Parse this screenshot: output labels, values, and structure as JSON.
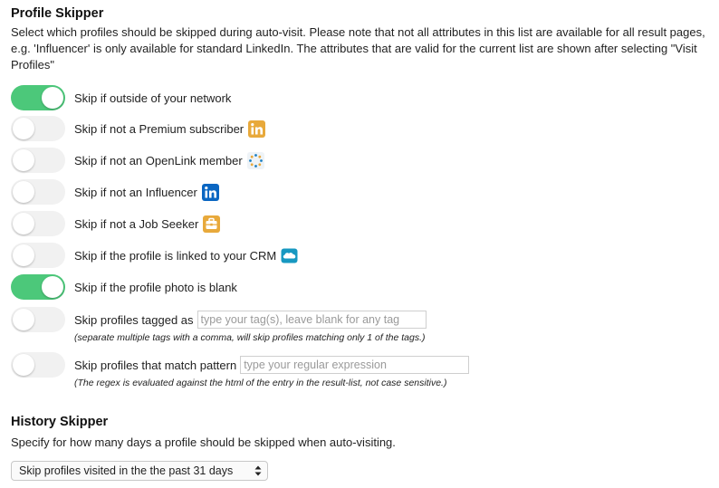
{
  "profile_skipper": {
    "title": "Profile Skipper",
    "description": "Select which profiles should be skipped during auto-visit. Please note that not all attributes in this list are available for all result pages, e.g. 'Influencer' is only available for standard LinkedIn. The attributes that are valid for the current list are shown after selecting \"Visit Profiles\"",
    "options": [
      {
        "label": "Skip if outside of your network",
        "enabled": true,
        "icon": ""
      },
      {
        "label": "Skip if not a Premium subscriber",
        "enabled": false,
        "icon": "linkedin-premium-icon"
      },
      {
        "label": "Skip if not an OpenLink member",
        "enabled": false,
        "icon": "openlink-icon"
      },
      {
        "label": "Skip if not an Influencer",
        "enabled": false,
        "icon": "linkedin-influencer-icon"
      },
      {
        "label": "Skip if not a Job Seeker",
        "enabled": false,
        "icon": "job-seeker-icon"
      },
      {
        "label": "Skip if the profile is linked to your CRM",
        "enabled": false,
        "icon": "salesforce-crm-icon"
      },
      {
        "label": "Skip if the profile photo is blank",
        "enabled": true,
        "icon": ""
      }
    ],
    "tags": {
      "label": "Skip profiles tagged as",
      "enabled": false,
      "placeholder": "type your tag(s), leave blank for any tag",
      "value": "",
      "hint": "(separate multiple tags with a comma, will skip profiles matching only 1 of the tags.)"
    },
    "pattern": {
      "label": "Skip profiles that match pattern",
      "enabled": false,
      "placeholder": "type your regular expression",
      "value": "",
      "hint": "(The regex is evaluated against the html of the entry in the result-list, not case sensitive.)"
    }
  },
  "history_skipper": {
    "title": "History Skipper",
    "description": "Specify for how many days a profile should be skipped when auto-visiting.",
    "select_value": "Skip profiles visited in the the past 31 days"
  },
  "colors": {
    "toggle_on": "#4cc87a",
    "toggle_off": "#f1f1f1",
    "premium_gold": "#e8a93b",
    "linkedin_blue": "#0a66c2",
    "salesforce_blue": "#1798c1"
  }
}
